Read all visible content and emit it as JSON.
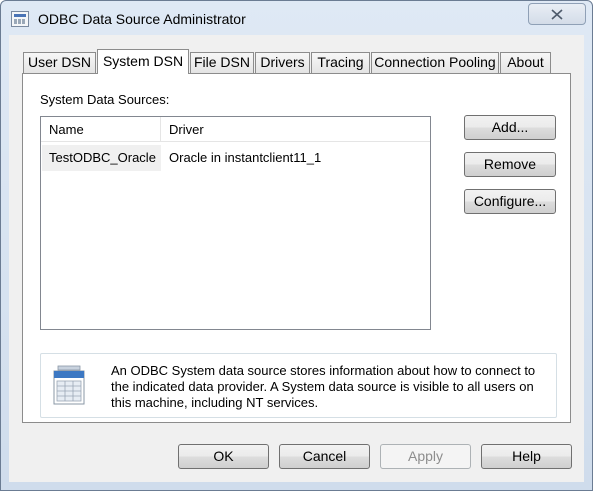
{
  "window": {
    "title": "ODBC Data Source Administrator"
  },
  "tabs": [
    {
      "label": "User DSN"
    },
    {
      "label": "System DSN"
    },
    {
      "label": "File DSN"
    },
    {
      "label": "Drivers"
    },
    {
      "label": "Tracing"
    },
    {
      "label": "Connection Pooling"
    },
    {
      "label": "About"
    }
  ],
  "active_tab": "System DSN",
  "system_dsn": {
    "section_label": "System Data Sources:",
    "columns": [
      "Name",
      "Driver"
    ],
    "rows": [
      {
        "name": "TestODBC_Oracle",
        "driver": "Oracle in instantclient11_1"
      }
    ],
    "buttons": {
      "add": "Add...",
      "remove": "Remove",
      "configure": "Configure..."
    },
    "info": "An ODBC System data source stores information about how to connect to the indicated data provider.   A System data source is visible to all users on this machine, including NT services."
  },
  "footer": {
    "ok": "OK",
    "cancel": "Cancel",
    "apply": "Apply",
    "help": "Help"
  },
  "icons": {
    "app": "odbc-admin-icon",
    "close": "close-icon",
    "info": "data-source-icon"
  }
}
